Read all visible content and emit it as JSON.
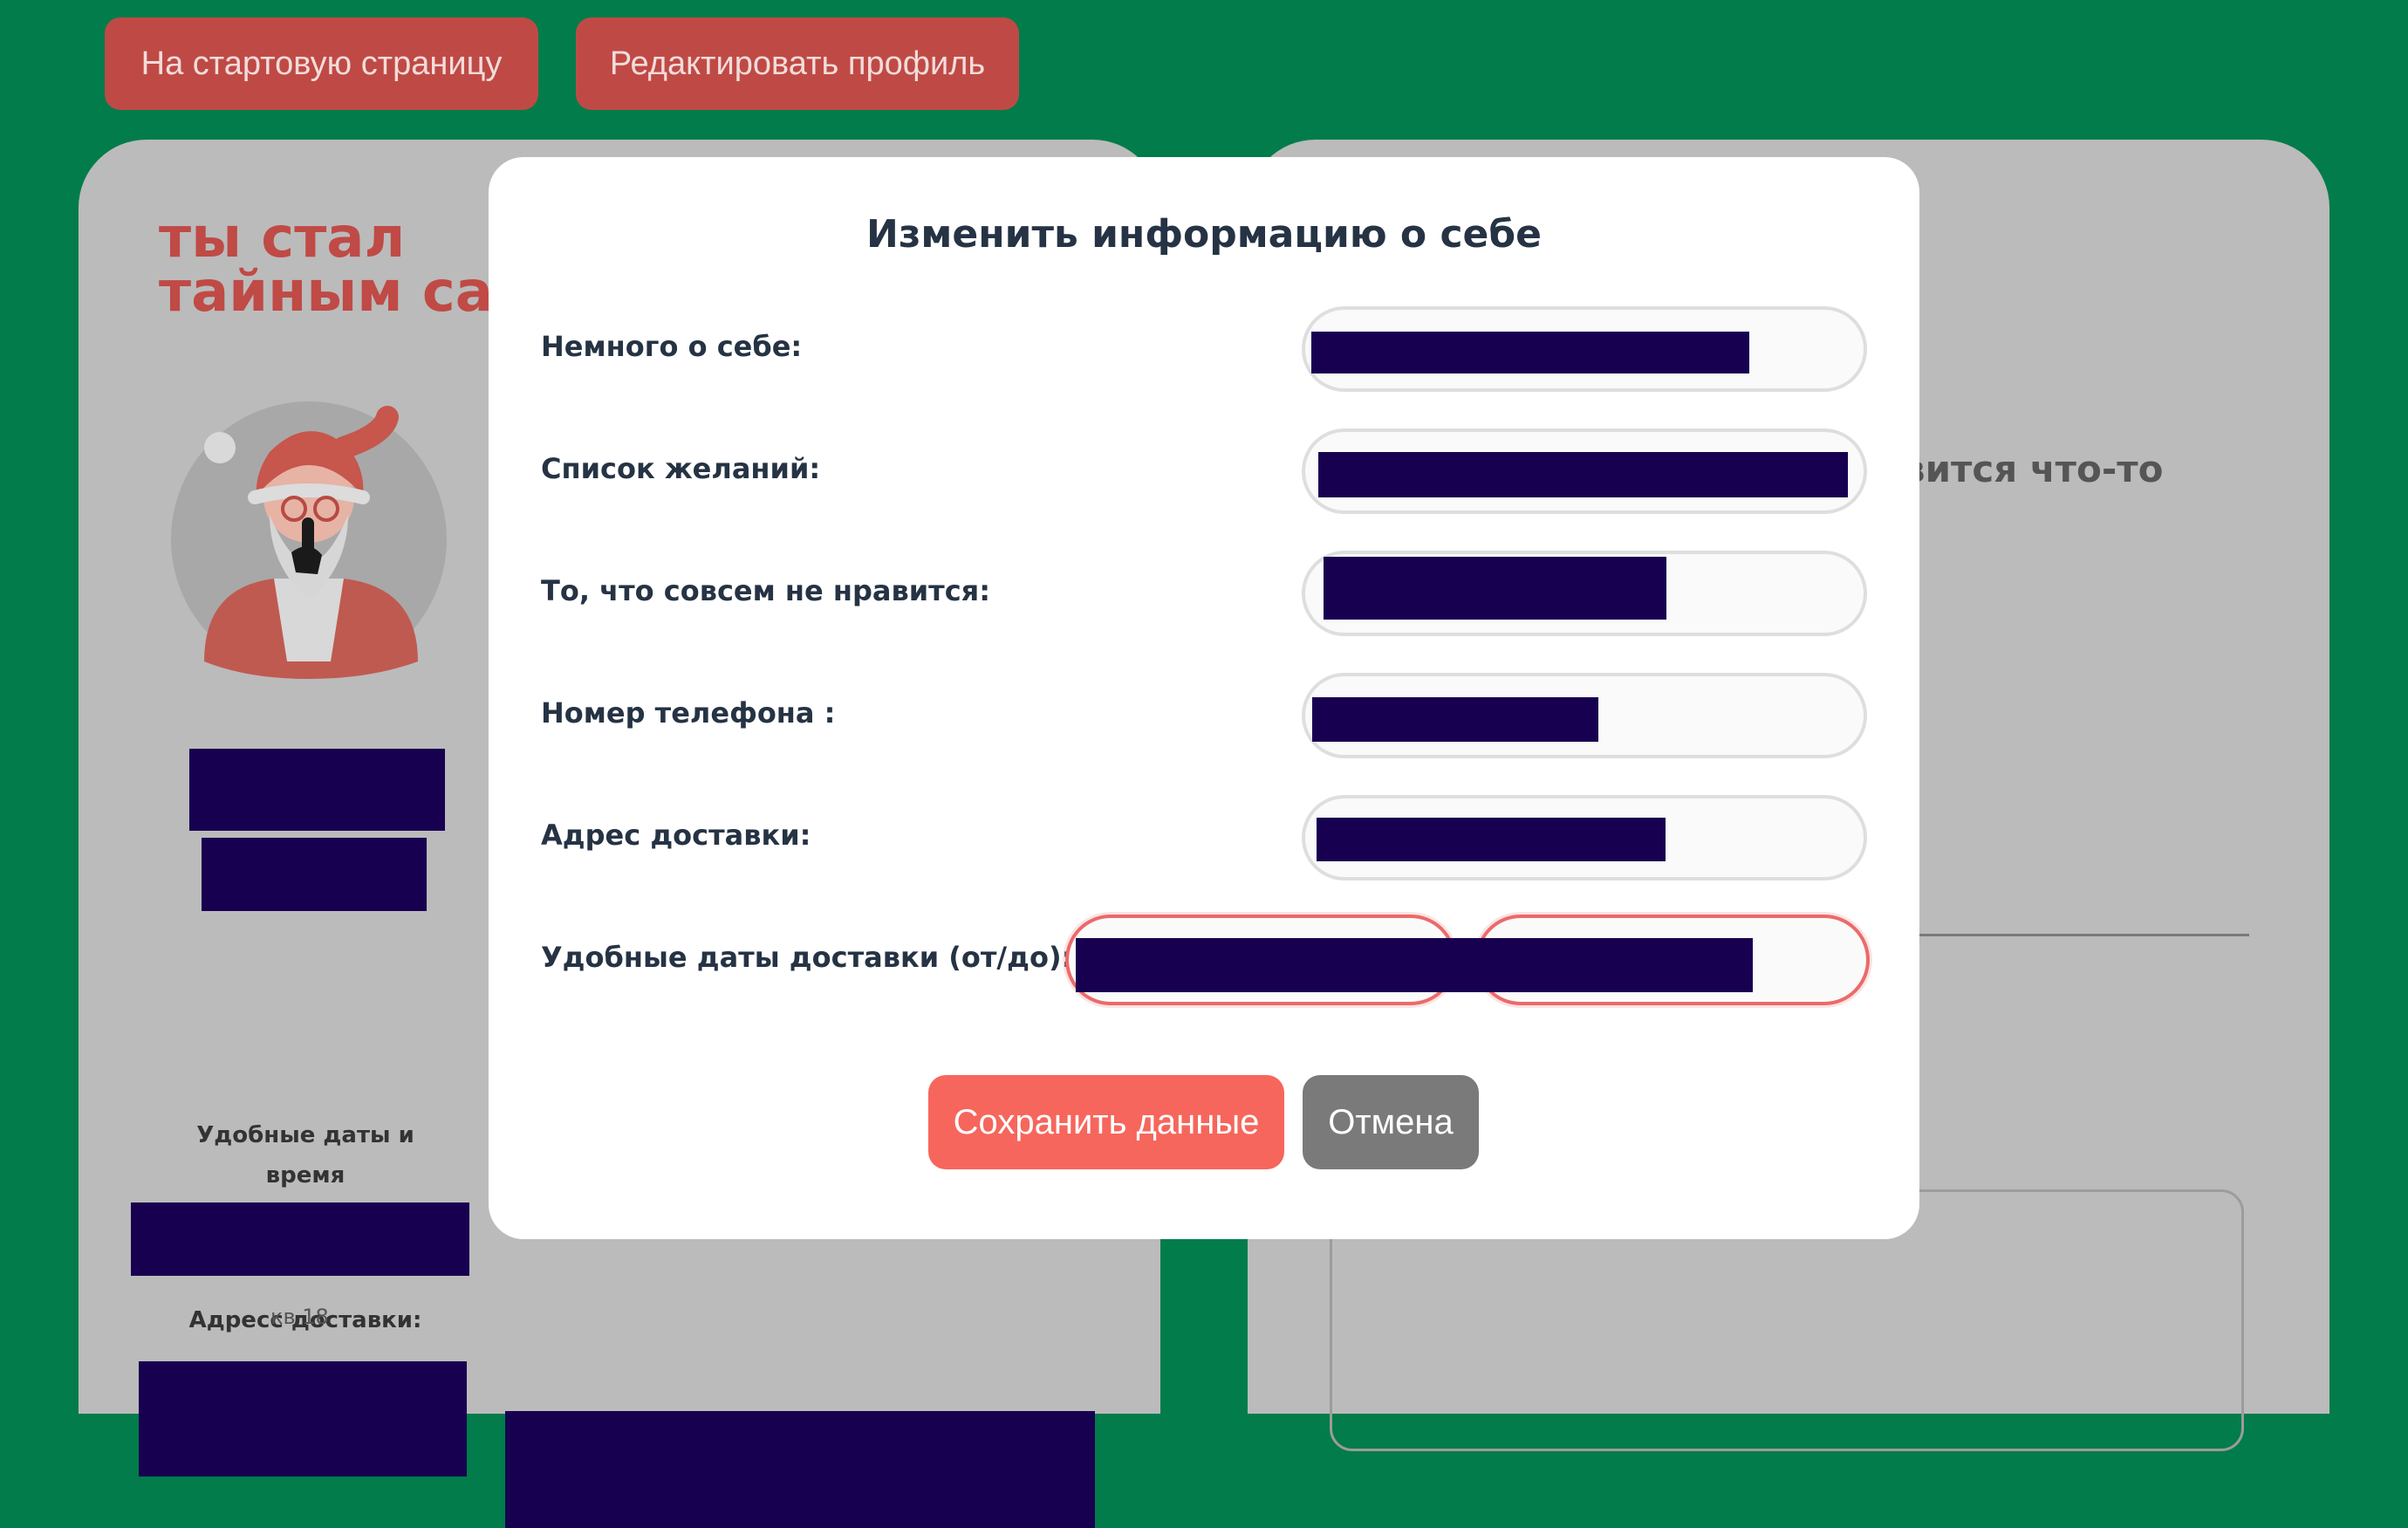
{
  "top_nav": {
    "home_label": "На стартовую страницу",
    "edit_label": "Редактировать профиль"
  },
  "left_card": {
    "title": "ты стал\nтайным са",
    "delivery_dates_label": "Удобные даты и время\nдоставки:",
    "address_label": "Адресс доставки:",
    "ghost_text": "кв 18"
  },
  "right_card": {
    "peek_text": "вится что-то"
  },
  "modal": {
    "title": "Изменить информацию о себе",
    "rows": [
      {
        "label": "Немного о себе:"
      },
      {
        "label": "Список желаний:"
      },
      {
        "label": "То, что совсем не нравится:"
      },
      {
        "label": "Номер телефона :"
      },
      {
        "label": "Адрес доставки:"
      },
      {
        "label": "Удобные даты доставки (от/до):"
      }
    ],
    "save_label": "Сохранить данные",
    "cancel_label": "Отмена"
  },
  "colors": {
    "page_bg": "#017c4a",
    "top_button": "#bf4a45",
    "card_bg": "#bbbbbb",
    "redaction": "#170050",
    "save_button": "#f6665c",
    "cancel_button": "#7a7a7a",
    "invalid_border": "#ec6a6a"
  }
}
